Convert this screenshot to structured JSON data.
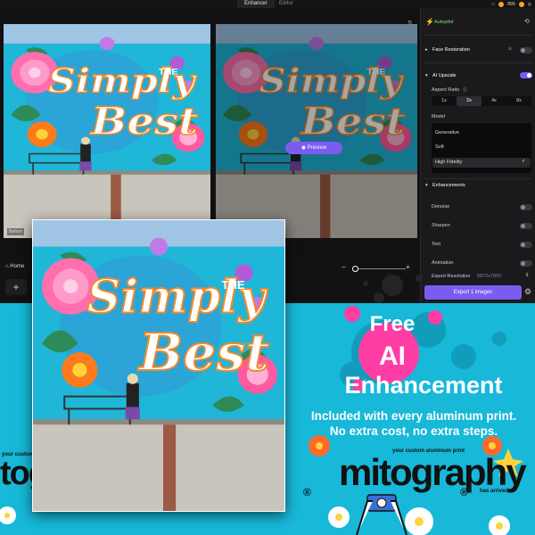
{
  "app": {
    "tabs": [
      "Enhancer",
      "Editor"
    ],
    "credits": "899",
    "before_label": "Before",
    "preview_label": "Preview",
    "home_label": "Home"
  },
  "side_panel": {
    "autopilot": "Autopilot",
    "face_restoration": "Face Restoration",
    "ai_upscale": "AI Upscale",
    "aspect_ratio_label": "Aspect Ratio",
    "aspect_ratios": [
      "1x",
      "2x",
      "4x",
      "8x"
    ],
    "aspect_ratio_selected": "2x",
    "model_label": "Model",
    "models": [
      "Generative",
      "Soft",
      "High Fidelity"
    ],
    "model_selected": "High Fidelity",
    "enhancements_label": "Enhancements",
    "denoise": "Denoise",
    "sharpen": "Sharpen",
    "text": "Text",
    "animation": "Animation",
    "export_resolution": "Export Resolution",
    "export_resolution_value": "5872x7800",
    "export_button": "Export 1 images"
  },
  "ad": {
    "free": "Free",
    "ai": "AI",
    "enhancement": "Enhancement",
    "line1": "Included with every aluminum print.",
    "line2": "No extra cost, no extra steps.",
    "brand": "mitography",
    "brand_tagline": "your custom aluminum print",
    "arrived": "has arrived",
    "reg": "®",
    "left_brand": "tography",
    "left_tagline": "your custom aluminum print"
  },
  "mural": {
    "line1": "Simply",
    "the": "THE",
    "line2": "Best"
  },
  "colors": {
    "accent": "#7b5cf0",
    "background": "#17b8d8",
    "badge": "#ff3ea5"
  }
}
